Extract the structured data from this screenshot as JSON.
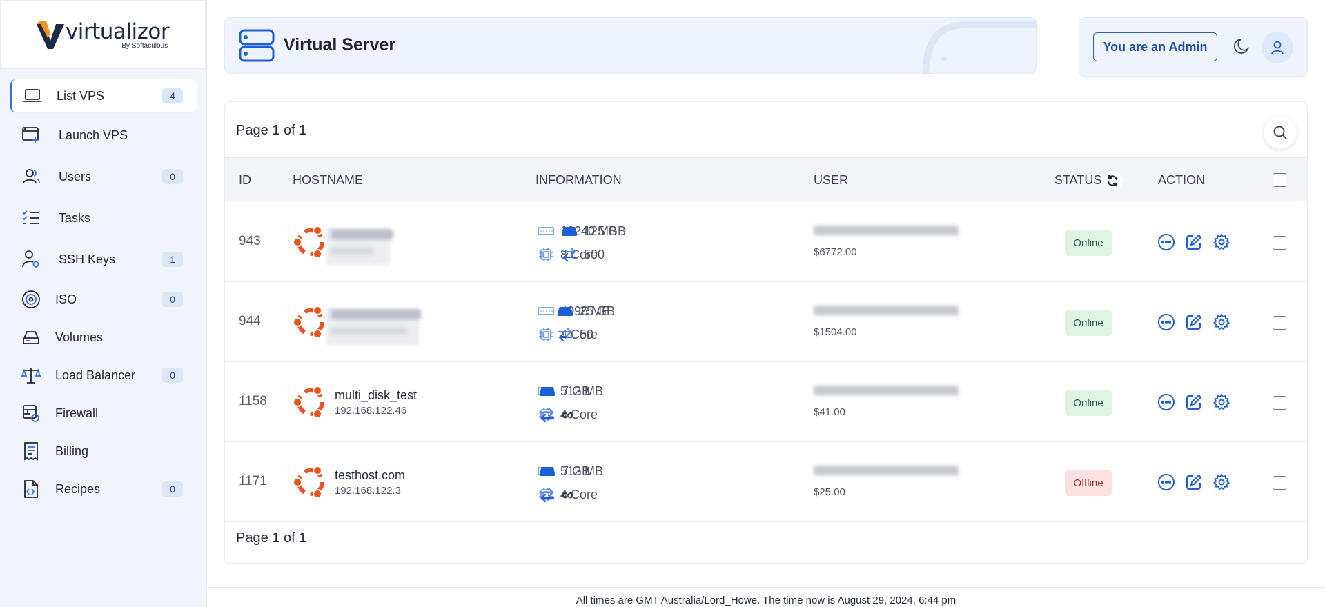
{
  "brand": {
    "name": "virtualizor",
    "sub": "By Softaculous"
  },
  "sidebar": {
    "items": [
      {
        "label": "List VPS",
        "badge": "4",
        "icon": "laptop-icon",
        "active": true
      },
      {
        "label": "Launch VPS",
        "badge": null,
        "icon": "window-plus-icon"
      },
      {
        "label": "Users",
        "badge": "0",
        "icon": "users-icon"
      },
      {
        "label": "Tasks",
        "badge": null,
        "icon": "checklist-icon"
      },
      {
        "label": "SSH Keys",
        "badge": "1",
        "icon": "user-key-icon"
      },
      {
        "label": "ISO",
        "badge": "0",
        "icon": "disc-icon"
      },
      {
        "label": "Volumes",
        "badge": null,
        "icon": "hard-drive-icon"
      },
      {
        "label": "Load Balancer",
        "badge": "0",
        "icon": "scale-icon"
      },
      {
        "label": "Firewall",
        "badge": null,
        "icon": "firewall-icon"
      },
      {
        "label": "Billing",
        "badge": null,
        "icon": "receipt-icon"
      },
      {
        "label": "Recipes",
        "badge": "0",
        "icon": "code-file-icon"
      }
    ]
  },
  "header": {
    "title": "Virtual Server",
    "icon": "server-icon"
  },
  "admin": {
    "label": "You are an Admin"
  },
  "table": {
    "page_top": "Page 1 of 1",
    "page_bottom": "Page 1 of 1",
    "columns": {
      "id": "ID",
      "hostname": "HOSTNAME",
      "information": "INFORMATION",
      "user": "USER",
      "status": "STATUS",
      "action": "ACTION"
    },
    "rows": [
      {
        "id": "943",
        "hostname": "",
        "ip": "",
        "ram": "10240 MB",
        "disk": "125 GB",
        "cpu": "8 Core",
        "bandwidth": "500",
        "amount": "$6772.00",
        "status": "Online"
      },
      {
        "id": "944",
        "hostname": "",
        "ip": "",
        "ram": "4096 MB",
        "disk": "25 GB",
        "cpu": "4 Core",
        "bandwidth": "50",
        "amount": "$1504.00",
        "status": "Online"
      },
      {
        "id": "1158",
        "hostname": "multi_disk_test",
        "ip": "192.168.122.46",
        "ram": "512 MB",
        "disk": "7 GB",
        "cpu": "4 Core",
        "bandwidth": "∞",
        "amount": "$41.00",
        "status": "Online"
      },
      {
        "id": "1171",
        "hostname": "testhost.com",
        "ip": "192.168.122.3",
        "ram": "512 MB",
        "disk": "7 GB",
        "cpu": "4 Core",
        "bandwidth": "∞",
        "amount": "$25.00",
        "status": "Offline"
      }
    ]
  },
  "footer": {
    "text": "All times are GMT Australia/Lord_Howe. The time now is August 29, 2024, 6:44 pm"
  },
  "colors": {
    "accent": "#1f5fd6",
    "ubuntu": "#e95420",
    "online_bg": "#def4e4",
    "offline_bg": "#fbe1e1"
  }
}
